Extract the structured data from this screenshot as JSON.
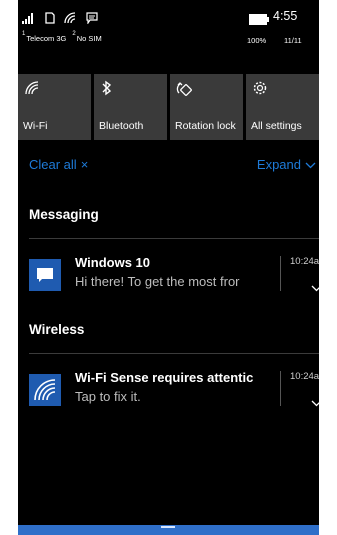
{
  "status_bar": {
    "sim1": {
      "index": "1",
      "carrier": "Telecom 3G"
    },
    "sim2": {
      "index": "2",
      "carrier": "No SIM"
    },
    "time": "4:55",
    "battery": "100%",
    "date": "11/11",
    "icons": [
      "signal-icon",
      "sim-icon",
      "wifi-icon",
      "message-icon",
      "battery-icon"
    ]
  },
  "quick_actions": [
    {
      "label": "Wi-Fi",
      "icon": "wifi-icon"
    },
    {
      "label": "Bluetooth",
      "icon": "bluetooth-icon"
    },
    {
      "label": "Rotation lock",
      "icon": "rotation-lock-icon"
    },
    {
      "label": "All settings",
      "icon": "gear-icon"
    }
  ],
  "actions": {
    "clear_all": "Clear all",
    "clear_all_glyph": "×",
    "expand": "Expand"
  },
  "groups": [
    {
      "title": "Messaging",
      "notifications": [
        {
          "title": "Windows 10",
          "body": "Hi there! To get the most fror",
          "time": "10:24a",
          "icon": "message-icon"
        }
      ]
    },
    {
      "title": "Wireless",
      "notifications": [
        {
          "title": "Wi-Fi Sense requires attentic",
          "body": "Tap to fix it.",
          "time": "10:24a",
          "icon": "wifi-sense-icon"
        }
      ]
    }
  ],
  "colors": {
    "accent": "#1e7bd9",
    "tile": "#3a3a3a",
    "app_icon": "#1f5bb0",
    "background": "#000000"
  }
}
